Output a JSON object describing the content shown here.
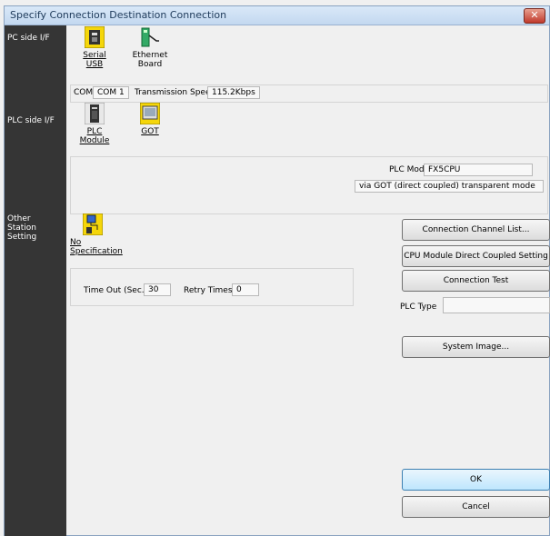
{
  "window": {
    "title": "Specify Connection Destination Connection",
    "close_glyph": "✕"
  },
  "sidebar": {
    "pc_side": "PC side I/F",
    "plc_side": "PLC side I/F",
    "other_station": "Other\nStation\nSetting"
  },
  "pc_side": {
    "serial": {
      "line1": "Serial",
      "line2": "USB"
    },
    "ethernet": {
      "line1": "Ethernet",
      "line2": "Board"
    },
    "com_label": "COM",
    "com_value": "COM 1",
    "speed_label": "Transmission Speed",
    "speed_value": "115.2Kbps"
  },
  "plc_side": {
    "plc_module": {
      "line1": "PLC",
      "line2": "Module"
    },
    "got": "GOT",
    "plc_mode_label": "PLC Mode",
    "plc_mode_value": "FX5CPU",
    "via_text": "via GOT (direct coupled) transparent mode"
  },
  "other_station": {
    "no_spec": "No Specification",
    "timeout_label": "Time Out (Sec.)",
    "timeout_value": "30",
    "retry_label": "Retry Times",
    "retry_value": "0"
  },
  "buttons": {
    "channel_list": "Connection Channel List...",
    "cpu_direct": "CPU Module Direct Coupled Setting",
    "conn_test": "Connection Test",
    "plc_type_label": "PLC Type",
    "plc_type_value": "",
    "system_image": "System Image...",
    "ok": "OK",
    "cancel": "Cancel"
  }
}
